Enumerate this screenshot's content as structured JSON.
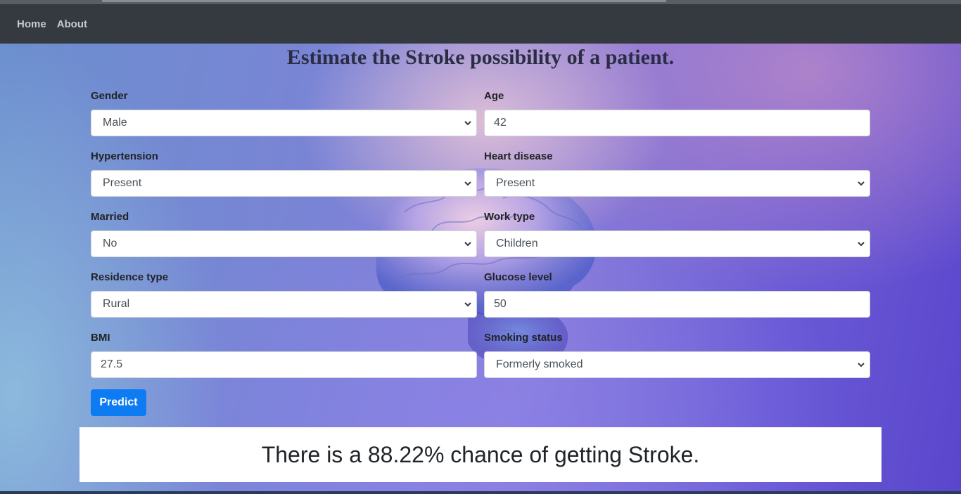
{
  "nav": {
    "links": [
      "Home",
      "About"
    ]
  },
  "title": "Estimate the Stroke possibility of a patient.",
  "form": {
    "gender": {
      "label": "Gender",
      "value": "Male"
    },
    "age": {
      "label": "Age",
      "value": "42"
    },
    "hypertension": {
      "label": "Hypertension",
      "value": "Present"
    },
    "heart_disease": {
      "label": "Heart disease",
      "value": "Present"
    },
    "married": {
      "label": "Married",
      "value": "No"
    },
    "work_type": {
      "label": "Work type",
      "value": "Children"
    },
    "residence_type": {
      "label": "Residence type",
      "value": "Rural"
    },
    "glucose_level": {
      "label": "Glucose level",
      "value": "50"
    },
    "bmi": {
      "label": "BMI",
      "value": "27.5"
    },
    "smoking_status": {
      "label": "Smoking status",
      "value": "Formerly smoked"
    }
  },
  "predict_label": "Predict",
  "result_text": "There is a 88.22% chance of getting Stroke.",
  "colors": {
    "navbar": "#343a40",
    "primary": "#0d7bf2",
    "result_bg": "#ffffff"
  },
  "icons": {
    "dropdown": "chevron-down-icon",
    "background": "brain-illustration"
  }
}
